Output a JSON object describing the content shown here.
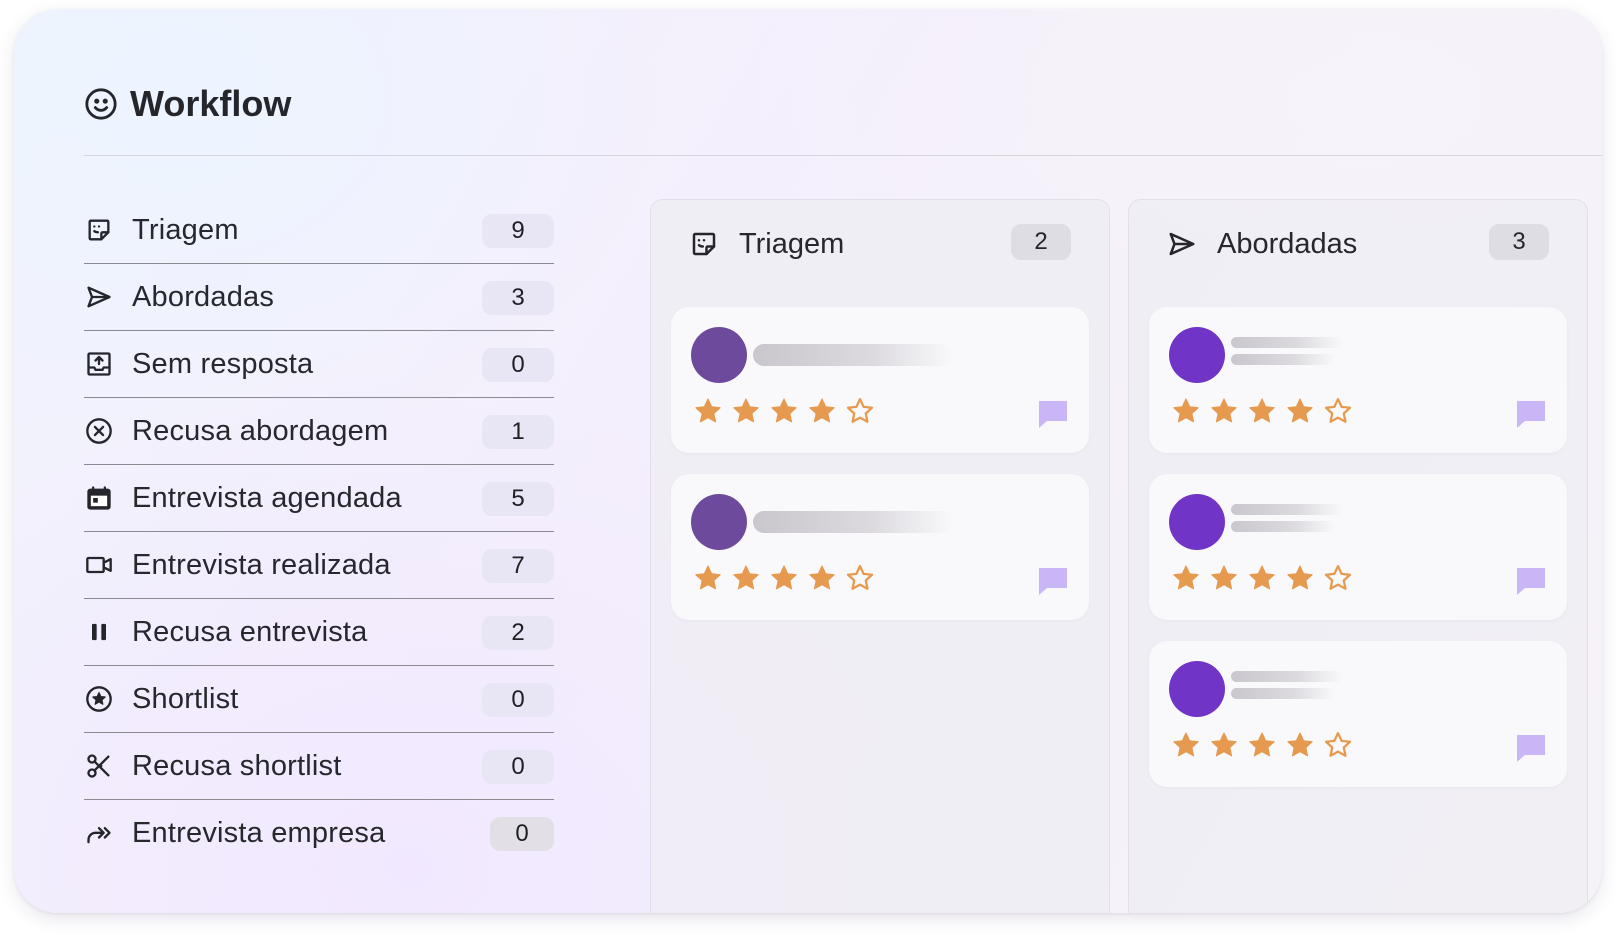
{
  "page": {
    "title": "Workflow",
    "title_icon": "smiley-icon"
  },
  "stages": [
    {
      "label": "Triagem",
      "count": "9",
      "icon": "sticky-note-icon"
    },
    {
      "label": "Abordadas",
      "count": "3",
      "icon": "send-icon"
    },
    {
      "label": "Sem resposta",
      "count": "0",
      "icon": "inbox-upload-icon"
    },
    {
      "label": "Recusa abordagem",
      "count": "1",
      "icon": "circle-x-icon"
    },
    {
      "label": "Entrevista agendada",
      "count": "5",
      "icon": "calendar-icon"
    },
    {
      "label": "Entrevista realizada",
      "count": "7",
      "icon": "video-icon"
    },
    {
      "label": "Recusa entrevista",
      "count": "2",
      "icon": "pause-icon"
    },
    {
      "label": "Shortlist",
      "count": "0",
      "icon": "star-circle-icon"
    },
    {
      "label": "Recusa shortlist",
      "count": "0",
      "icon": "scissors-icon"
    },
    {
      "label": "Entrevista empresa",
      "count": "0",
      "icon": "forward-icon"
    }
  ],
  "columns": [
    {
      "label": "Triagem",
      "count": "2",
      "icon": "sticky-note-icon",
      "avatar_color": "#6e4a9d",
      "cards": [
        {
          "rating": 4,
          "max": 5
        },
        {
          "rating": 4,
          "max": 5
        }
      ]
    },
    {
      "label": "Abordadas",
      "count": "3",
      "icon": "send-icon",
      "avatar_color": "#7034c6",
      "cards": [
        {
          "rating": 4,
          "max": 5
        },
        {
          "rating": 4,
          "max": 5
        },
        {
          "rating": 4,
          "max": 5
        }
      ]
    }
  ],
  "colors": {
    "star": "#e59a4f",
    "comment": "#c9b6f7",
    "count_badge": "#e8e5f4"
  }
}
